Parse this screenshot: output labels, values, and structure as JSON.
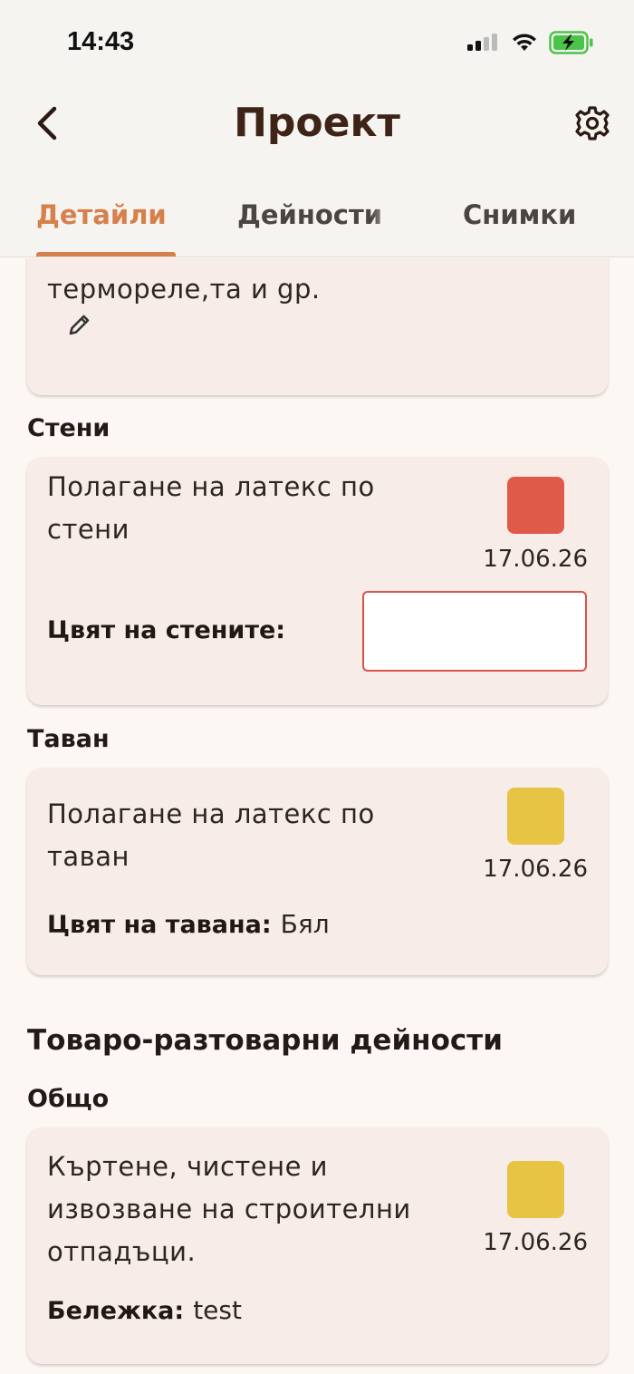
{
  "status_bar": {
    "time": "14:43",
    "icons": [
      "signal-icon",
      "wifi-icon",
      "battery-charging-icon"
    ]
  },
  "header": {
    "title": "Проект",
    "back_icon": "chevron-left-icon",
    "settings_icon": "gear-icon"
  },
  "tabs": [
    {
      "label": "Детайли",
      "active": true
    },
    {
      "label": "Дейности",
      "active": false
    },
    {
      "label": "Снимки",
      "active": false
    }
  ],
  "description_card": {
    "visible_text": "термореле,та и gр."
  },
  "sections": [
    {
      "label": "Стени",
      "task": "Полагане на латекс по стени",
      "task_lines": [
        "Полагане на латекс по",
        "стени"
      ],
      "status_color": "#e05a4a",
      "date": "17.06.26",
      "field_label": "Цвят на стените:",
      "field_value": ""
    },
    {
      "label": "Таван",
      "task": "Полагане на латекс по таван",
      "task_lines": [
        "Полагане на латекс по",
        "таван"
      ],
      "status_color": "#e8c444",
      "date": "17.06.26",
      "field_label": "Цвят на тавана:",
      "field_value": "Бял"
    }
  ],
  "group": {
    "heading": "Товаро-разтоварни дейности",
    "sections": [
      {
        "label": "Общо",
        "task_lines": [
          "Къртене, чистене и",
          "извозване на строителни",
          "отпадъци."
        ],
        "status_color": "#e8c444",
        "date": "17.06.26",
        "note_label": "Бележка:",
        "note_value": "test"
      }
    ]
  },
  "colors": {
    "accent": "#d6804c",
    "title": "#3e2417",
    "card_bg": "#f8ece8",
    "page_bg": "#fdf7f4",
    "status_red": "#e05a4a",
    "status_yellow": "#e8c444"
  }
}
